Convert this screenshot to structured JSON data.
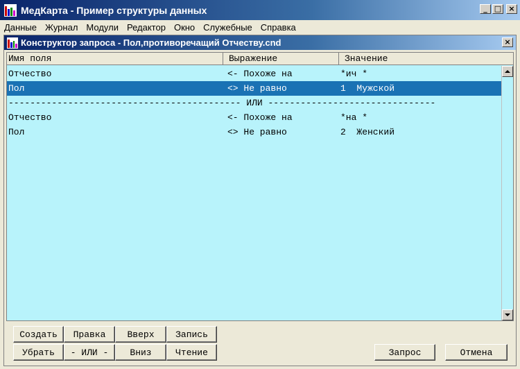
{
  "app": {
    "title": "МедКарта - Пример структуры данных",
    "icon": "app-bars-icon",
    "icon_colors": [
      "#cc0000",
      "#0000cc",
      "#008800",
      "#cc00cc"
    ]
  },
  "window_controls": {
    "minimize": "_",
    "maximize": "□",
    "close": "×"
  },
  "menu": [
    "Данные",
    "Журнал",
    "Модули",
    "Редактор",
    "Окно",
    "Служебные",
    "Справка"
  ],
  "child": {
    "title": "Конструктор запроса  - Пол,противоречащий Отчеству.cnd",
    "close": "×"
  },
  "grid": {
    "columns": [
      "Имя поля",
      "Выражение",
      "Значение"
    ],
    "rows": [
      {
        "field": "Отчество",
        "expr": "<- Похоже на",
        "value": "*ич *"
      },
      {
        "field": "Пол",
        "expr": "<> Не равно",
        "value": "1  Мужской",
        "selected": true
      },
      {
        "divider": "------------------------------------------- ИЛИ -------------------------------"
      },
      {
        "field": "Отчество",
        "expr": "<- Похоже на",
        "value": "*на *"
      },
      {
        "field": "Пол",
        "expr": "<> Не равно",
        "value": "2  Женский"
      }
    ]
  },
  "buttons": {
    "create": "Создать",
    "edit": "Правка",
    "up": "Вверх",
    "save": "Запись",
    "remove": "Убрать",
    "or": "- ИЛИ -",
    "down": "Вниз",
    "read": "Чтение",
    "query": "Запрос",
    "cancel": "Отмена"
  },
  "colors": {
    "grid_bg": "#b8f3fb",
    "selection": "#1a72b4",
    "title_bar": "#0a246a"
  }
}
